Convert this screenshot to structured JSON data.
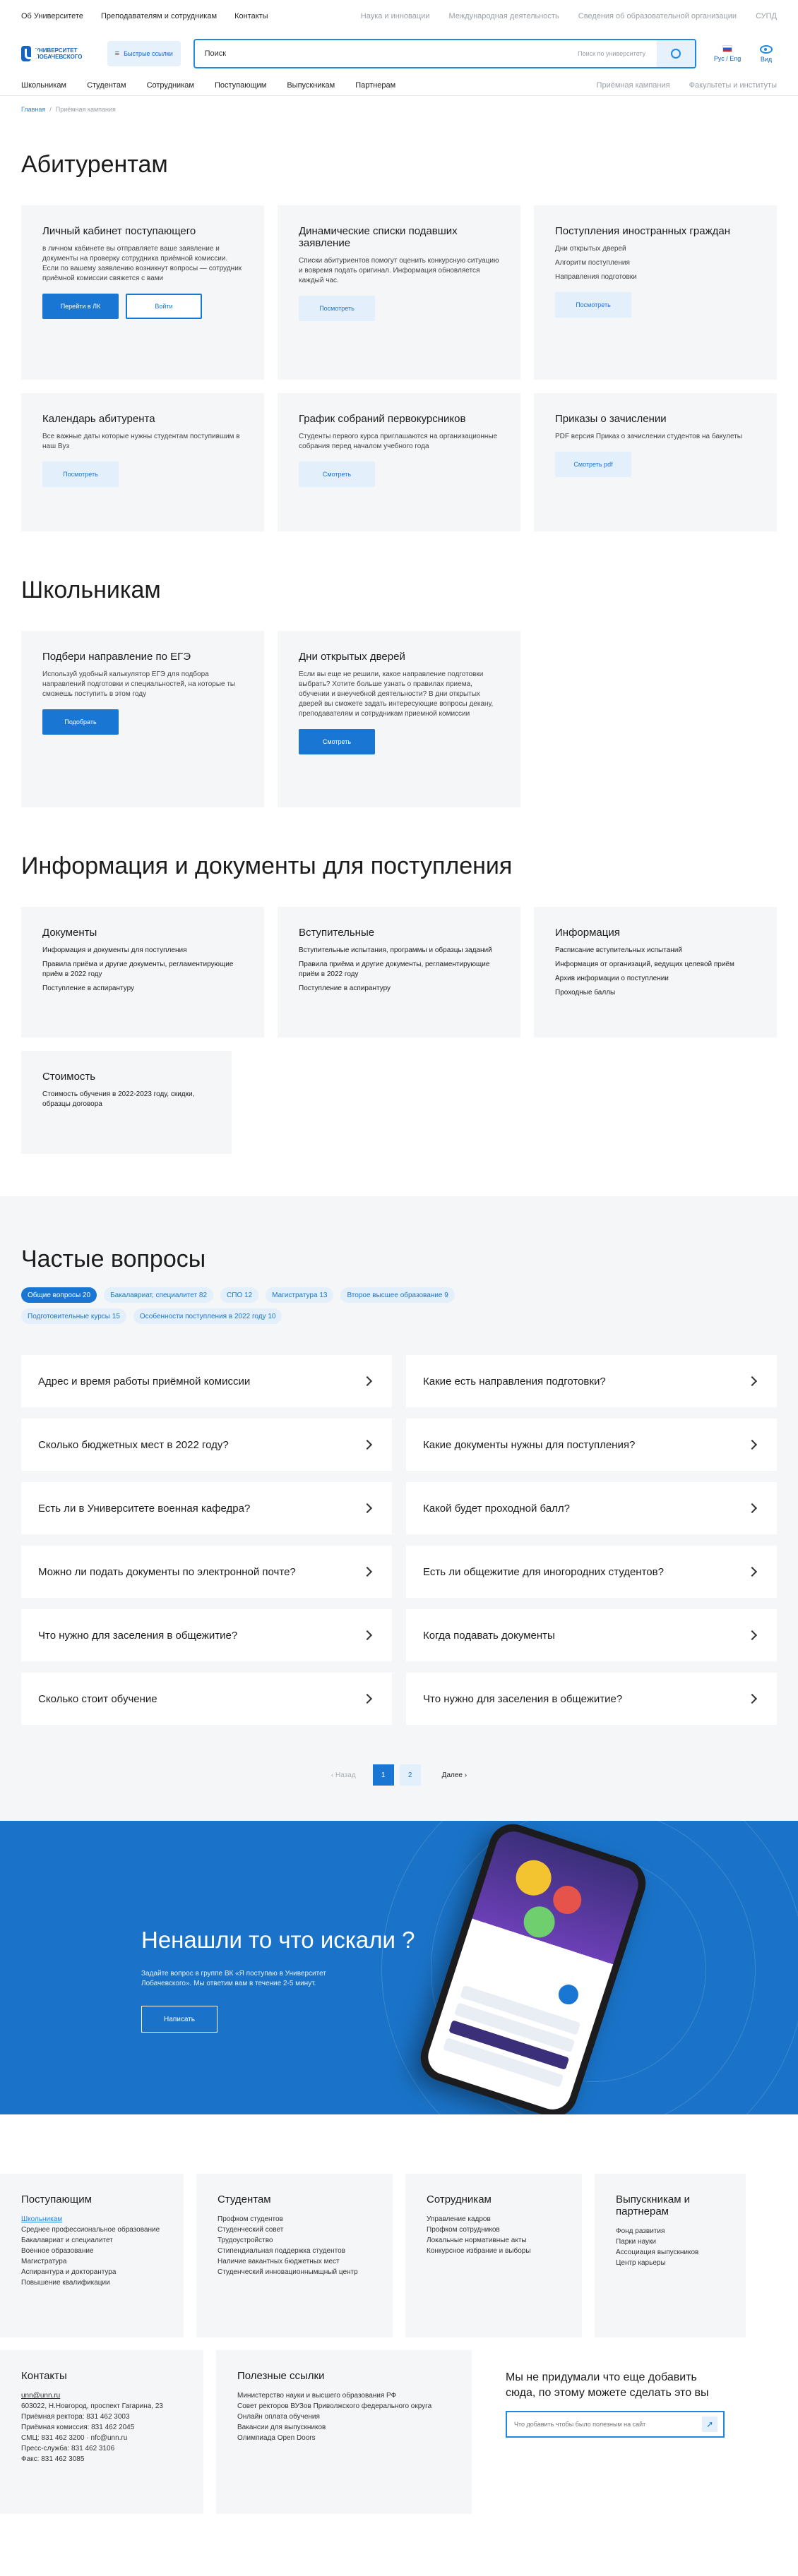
{
  "topbar": {
    "left": [
      "Об Университете",
      "Преподавателям и сотрудникам",
      "Контакты"
    ],
    "right": [
      "Наука и инновации",
      "Международная деятельность",
      "Сведения об образовательной организации",
      "СУПД"
    ]
  },
  "header": {
    "logo_text": "Университет Лобачевского",
    "quick_access": "Быстрые ссылки",
    "search_placeholder": "Поиск",
    "search_scope": "Поиск по университету",
    "lang": "Рус / Eng",
    "vision": "Вид"
  },
  "nav": {
    "left": [
      "Школьникам",
      "Студентам",
      "Сотрудникам",
      "Поступающим",
      "Выпускникам",
      "Партнерам"
    ],
    "right": [
      "Приёмная кампания",
      "Факультеты и институты"
    ]
  },
  "breadcrumb": {
    "home": "Главная",
    "sep": "/",
    "current": "Приёмная кампания"
  },
  "abitur": {
    "title": "Абитурентам",
    "cards": [
      {
        "title": "Личный кабинет поступающего",
        "text": "в личном кабинете вы отправляете ваше заявление и документы на проверку сотрудника приёмной комиссии. Если по вашему заявлению возникнут вопросы — сотрудник приёмной комиссии свяжется с вами",
        "btn1": "Перейти в ЛК",
        "btn2": "Войти"
      },
      {
        "title": "Динамические списки подавших заявление",
        "text": "Списки абитуриентов помогут оценить конкурсную ситуацию и вовремя подать оригинал. Информация обновляется каждый час.",
        "btn1": "Посмотреть"
      },
      {
        "title": "Поступления иностранных граждан",
        "links": [
          "Дни открытых дверей",
          "Алгоритм поступления",
          "Направления подготовки"
        ],
        "btn1": "Посмотреть"
      },
      {
        "title": "Календарь абитурента",
        "text": "Все важные даты которые нужны студентам поступившим в наш Вуз",
        "btn1": "Посмотреть"
      },
      {
        "title": "График собраний первокурсников",
        "text": "Студенты первого курса приглашаются на организационные собрания перед началом учебного года",
        "btn1": "Смотреть"
      },
      {
        "title": "Приказы о зачислении",
        "text": "PDF версия Приказ о зачислении студентов на бакулеты",
        "btn1": "Смотреть pdf"
      }
    ]
  },
  "school": {
    "title": "Школьникам",
    "cards": [
      {
        "title": "Подбери направление по ЕГЭ",
        "text": "Используй удобный калькулятор ЕГЭ для подбора направлений подготовки и специальностей, на которые ты сможешь поступить в этом году",
        "btn1": "Подобрать"
      },
      {
        "title": "Дни открытых дверей",
        "text": "Если вы еще не решили, какое направление подготовки выбрать? Хотите больше узнать о правилах приема, обучении и внеучебной деятельности? В дни открытых дверей вы сможете задать интересующие вопросы декану, преподавателям и сотрудникам приемной комиссии",
        "btn1": "Смотреть"
      }
    ]
  },
  "docs": {
    "title": "Информация и документы для поступления",
    "cards": [
      {
        "title": "Документы",
        "links": [
          "Информация и документы для поступления",
          "Правила приёма и другие документы, регламентирующие приём в 2022 году",
          "Поступление в аспирантуру"
        ]
      },
      {
        "title": "Вступительные",
        "links": [
          "Вступительные испытания, программы и образцы заданий",
          "Правила приёма и другие документы, регламентирующие приём в 2022 году",
          "Поступление в аспирантуру"
        ]
      },
      {
        "title": "Информация",
        "links": [
          "Расписание вступительных испытаний",
          "Информация от организаций, ведущих целевой приём",
          "Архив информации о поступлении",
          "Проходные баллы"
        ]
      },
      {
        "title": "Стоимость",
        "links": [
          "Стоимость обучения в 2022-2023 году, скидки, образцы договора"
        ]
      }
    ]
  },
  "faq": {
    "title": "Частые вопросы",
    "chips": [
      "Общие вопросы 20",
      "Бакалавриат, специалитет 82",
      "СПО 12",
      "Магистратура 13",
      "Второе высшее образование 9",
      "Подготовительные курсы 15",
      "Особенности поступления в 2022 году 10"
    ],
    "questions": [
      "Адрес и время работы приёмной комиссии",
      "Какие есть направления подготовки?",
      "Сколько бюджетных мест в 2022 году?",
      "Какие документы нужны для поступления?",
      "Есть ли в Университете военная кафедра?",
      "Какой будет проходной балл?",
      "Можно ли подать документы по электронной почте?",
      "Есть ли общежитие для иногородних студентов?",
      "Что нужно для заселения в общежитие?",
      "Когда подавать документы",
      "Сколько стоит обучение",
      "Что нужно для заселения в общежитие?"
    ],
    "pager": {
      "prev": "Назад",
      "pages": [
        "1",
        "2"
      ],
      "next": "Далее"
    }
  },
  "promo": {
    "title": "Ненашли то что искали ?",
    "text": "Задайте вопрос в группе ВК «Я поступаю в Университет Лобачевского». Мы ответим вам в течение 2-5 минут.",
    "button": "Написать"
  },
  "footer": {
    "columns": [
      {
        "title": "Поступающим",
        "links": [
          "Школьникам",
          "Среднее профессиональное образование",
          "Бакалавриат и специалитет",
          "Военное образование",
          "Магистратура",
          "Аспирантура и докторантура",
          "Повышение квалификации"
        ]
      },
      {
        "title": "Студентам",
        "links": [
          "Профком студентов",
          "Студенческий совет",
          "Трудоустройство",
          "Стипендиальная поддержка студентов",
          "Наличие вакантных бюджетных мест",
          "Студенческий инновационнымщный центр"
        ]
      },
      {
        "title": "Сотрудникам",
        "links": [
          "Управление кадров",
          "Профком сотрудников",
          "Локальные нормативные акты",
          "Конкурсное избрание и выборы"
        ]
      },
      {
        "title": "Выпускникам и партнерам",
        "links": [
          "Фонд развития",
          "Парки науки",
          "Ассоциация выпускников",
          "Центр карьеры"
        ]
      }
    ],
    "contacts": {
      "title": "Контакты",
      "lines": [
        "unn@unn.ru",
        "603022, Н.Новгород, проспект Гагарина, 23",
        "Приёмная ректора: 831 462 3003",
        "Приёмная комиссия: 831 462 2045",
        "СМЦ: 831 462 3200 · nfc@unn.ru",
        "Пресс-служба: 831 462 3106",
        "Факс: 831 462 3085"
      ]
    },
    "useful": {
      "title": "Полезные ссылки",
      "links": [
        "Министерство науки и высшего образования РФ",
        "Совет ректоров ВУЗов Приволжского федерального округа",
        "Онлайн оплата обучения",
        "Вакансии для выпускников",
        "Олимпиада Open Doors"
      ]
    },
    "ask": {
      "title": "Мы не придумали что еще добавить сюда, по этому можете сделать это вы",
      "placeholder": "Что добавить чтобы было полезным на сайт"
    }
  }
}
